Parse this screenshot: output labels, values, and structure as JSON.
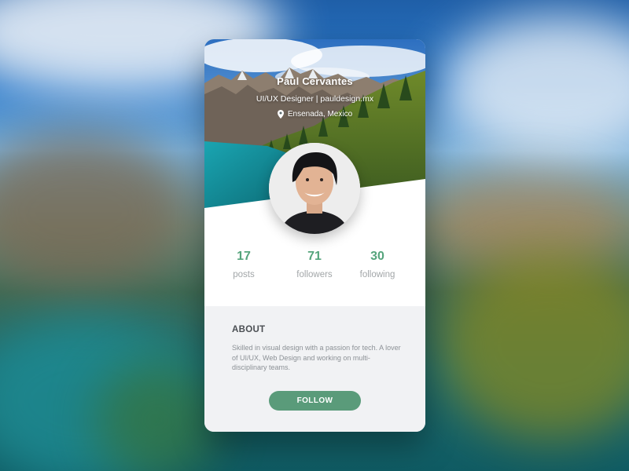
{
  "profile": {
    "name": "Paul Cervantes",
    "subtitle": "UI/UX Designer  |  pauldesign.mx",
    "location": "Ensenada, Mexico"
  },
  "stats": [
    {
      "value": "17",
      "label": "posts"
    },
    {
      "value": "71",
      "label": "followers"
    },
    {
      "value": "30",
      "label": "following"
    }
  ],
  "about": {
    "title": "ABOUT",
    "text": "Skilled in visual design with a passion for tech. A lover of UI/UX, Web Design and working on multi-disciplinary teams."
  },
  "follow_button": {
    "label": "FOLLOW"
  },
  "colors": {
    "accent": "#55a47c",
    "button": "#5a9b7a",
    "about_bg": "#f1f2f4",
    "stat_label": "#a2a6a8"
  },
  "icons": {
    "location": "map-pin-icon"
  }
}
